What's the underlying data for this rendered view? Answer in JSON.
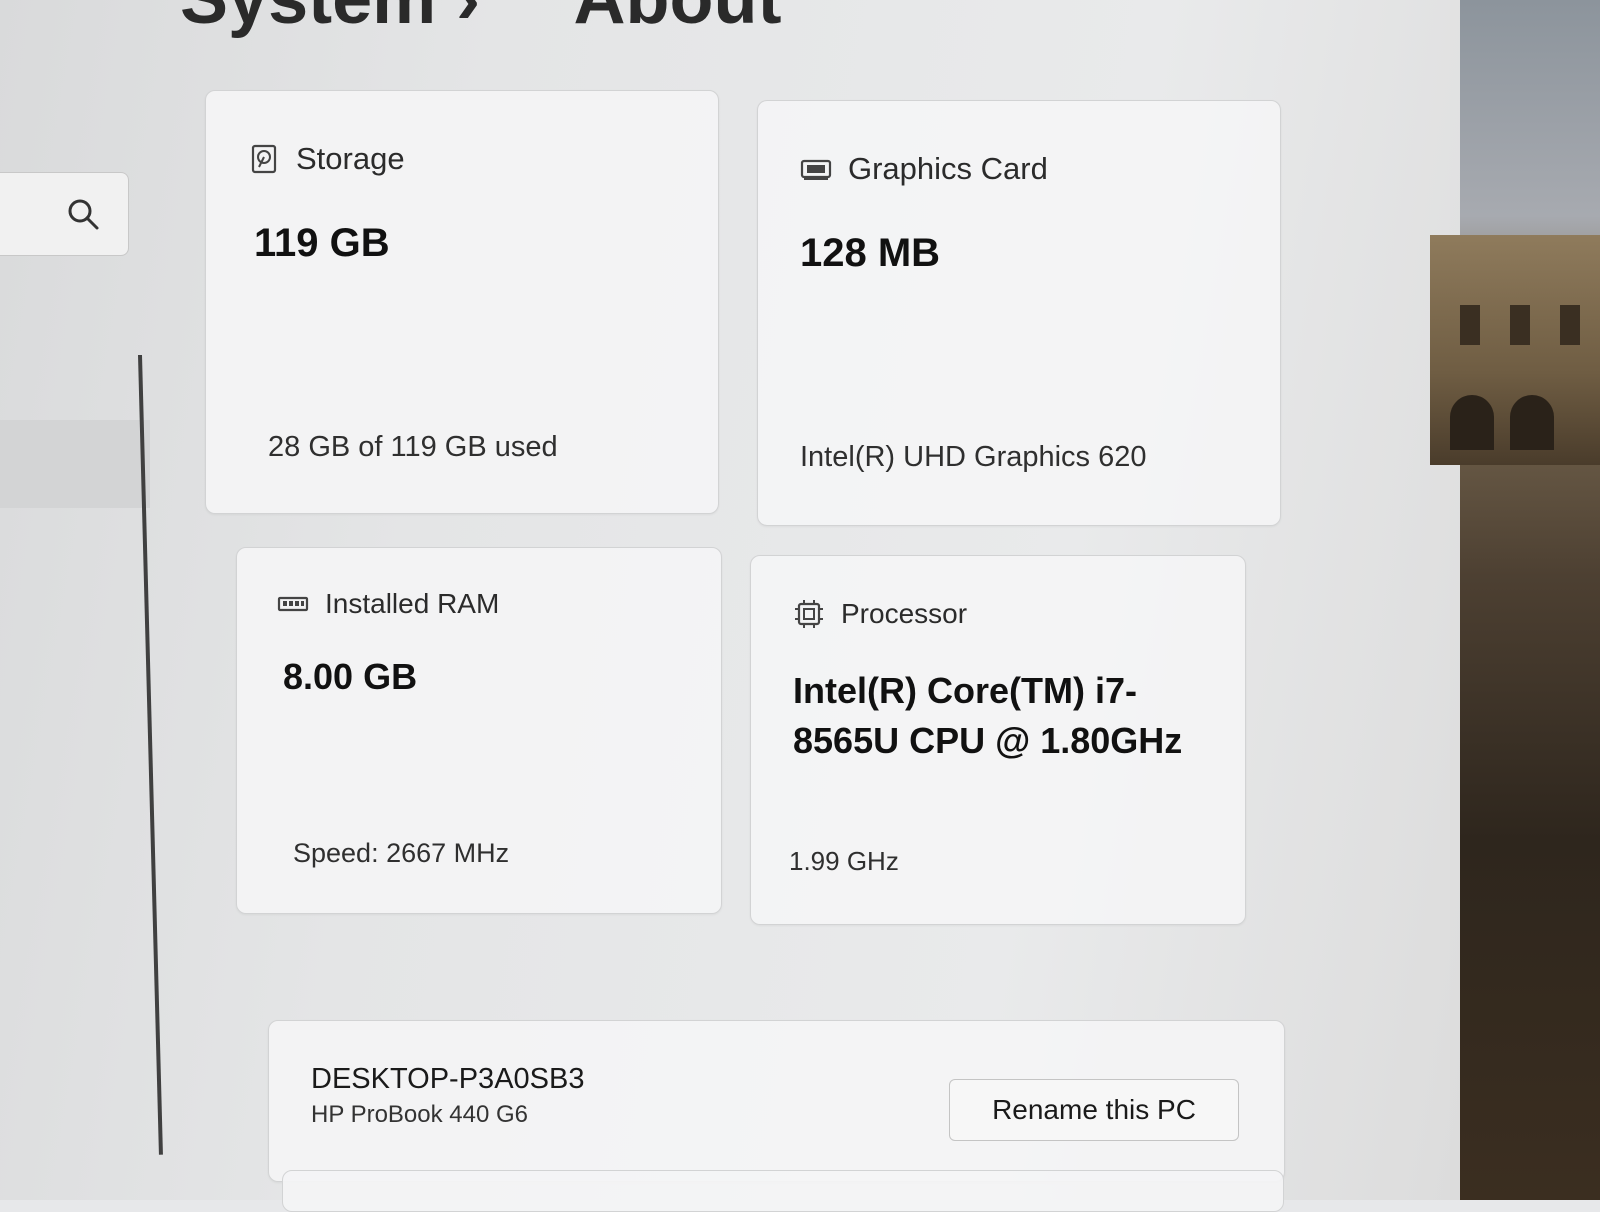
{
  "header": {
    "breadcrumb_parent": "System",
    "breadcrumb_separator": "›",
    "page_title": "About"
  },
  "search": {
    "icon": "search-icon"
  },
  "specs": {
    "storage": {
      "title": "Storage",
      "value": "119 GB",
      "detail": "28 GB of 119 GB used",
      "icon": "storage-icon"
    },
    "graphics": {
      "title": "Graphics Card",
      "value": "128 MB",
      "detail": "Intel(R) UHD Graphics 620",
      "icon": "graphics-card-icon"
    },
    "ram": {
      "title": "Installed RAM",
      "value": "8.00 GB",
      "detail": "Speed: 2667 MHz",
      "icon": "ram-icon"
    },
    "processor": {
      "title": "Processor",
      "value": "Intel(R) Core(TM) i7-8565U CPU @ 1.80GHz",
      "detail": "1.99 GHz",
      "icon": "processor-icon"
    }
  },
  "device": {
    "name": "DESKTOP-P3A0SB3",
    "model": "HP ProBook 440 G6",
    "rename_label": "Rename this PC"
  }
}
